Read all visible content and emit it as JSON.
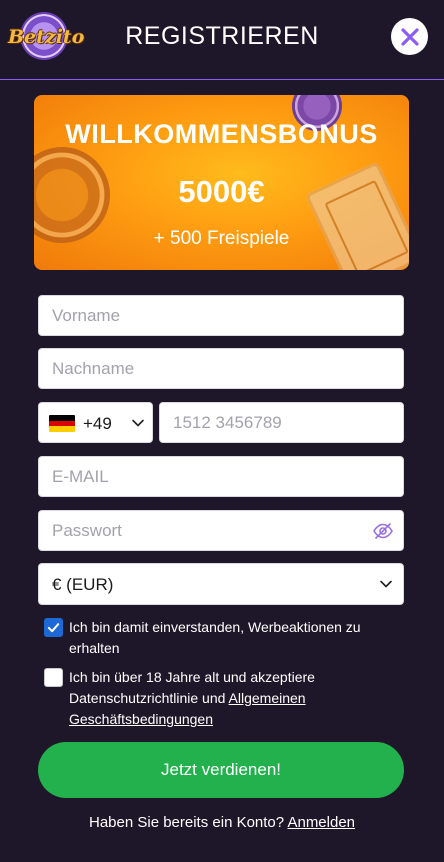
{
  "header": {
    "logo_text": "Betzito",
    "title": "REGISTRIEREN",
    "close_icon": "close-icon"
  },
  "banner": {
    "title": "WILLKOMMENSBONUS",
    "amount": "5000€",
    "spins": "+ 500 Freispiele"
  },
  "form": {
    "first_name_placeholder": "Vorname",
    "last_name_placeholder": "Nachname",
    "country_code": "+49",
    "country_flag": "flag-germany-icon",
    "phone_placeholder": "1512 3456789",
    "email_placeholder": "E-MAIL",
    "password_placeholder": "Passwort",
    "currency": "€ (EUR)"
  },
  "consents": {
    "promo_text": "Ich bin damit einverstanden, Werbeaktionen zu erhalten",
    "promo_checked": true,
    "age_text_prefix": "Ich bin über 18 Jahre alt und akzeptiere Datenschutzrichtlinie und ",
    "age_link": "Allgemeinen Geschäftsbedingungen",
    "age_checked": false
  },
  "submit_label": "Jetzt verdienen!",
  "login": {
    "prompt": "Haben Sie bereits ein Konto? ",
    "link": "Anmelden"
  },
  "colors": {
    "background": "#1e1729",
    "accent": "#8b5cf6",
    "button": "#22b14c",
    "checkbox": "#1f69d6"
  }
}
